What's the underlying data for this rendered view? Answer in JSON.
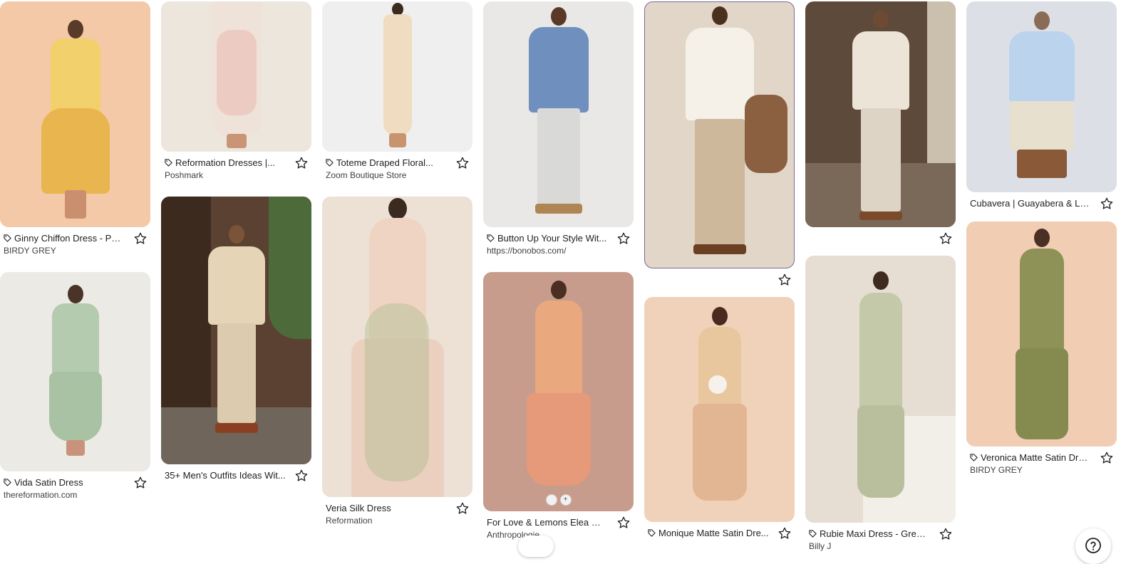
{
  "results": [
    {
      "title": "Ginny Chiffon Dress - Pal...",
      "source": "BIRDY GREY",
      "tag": true,
      "icon": "dress-thumbnail"
    },
    {
      "title": "Vida Satin Dress",
      "source": "thereformation.com",
      "tag": true,
      "icon": "dress-thumbnail"
    },
    {
      "title": "Reformation Dresses |...",
      "source": "Poshmark",
      "tag": true,
      "icon": "dress-thumbnail"
    },
    {
      "title": "35+ Men's Outfits Ideas Wit...",
      "source": "",
      "tag": false,
      "icon": "outfit-thumbnail"
    },
    {
      "title": "Toteme Draped Floral...",
      "source": "Zoom Boutique Store",
      "tag": true,
      "icon": "dress-thumbnail"
    },
    {
      "title": "Veria Silk Dress",
      "source": "Reformation",
      "tag": false,
      "icon": "dress-thumbnail"
    },
    {
      "title": "Button Up Your Style Wit...",
      "source": "https://bonobos.com/",
      "tag": true,
      "icon": "outfit-thumbnail"
    },
    {
      "title": "For Love & Lemons Elea Ma...",
      "source": "Anthropologie",
      "tag": false,
      "icon": "dress-thumbnail"
    },
    {
      "title": "",
      "source": "",
      "tag": false,
      "icon": "outfit-thumbnail"
    },
    {
      "title": "Monique Matte Satin Dre...",
      "source": "",
      "tag": true,
      "icon": "dress-thumbnail"
    },
    {
      "title": "",
      "source": "",
      "tag": false,
      "icon": "outfit-thumbnail"
    },
    {
      "title": "Rubie Maxi Dress - Green...",
      "source": "Billy J",
      "tag": true,
      "icon": "dress-thumbnail"
    },
    {
      "title": "Cubavera | Guayabera & Lin...",
      "source": "",
      "tag": false,
      "icon": "outfit-thumbnail"
    },
    {
      "title": "Veronica Matte Satin Dres...",
      "source": "BIRDY GREY",
      "tag": true,
      "icon": "dress-thumbnail"
    }
  ],
  "colors": {
    "text_primary": "#202124",
    "text_secondary": "#3c4043",
    "icon": "#202124"
  },
  "help_button": {
    "icon": "help-question-icon"
  }
}
